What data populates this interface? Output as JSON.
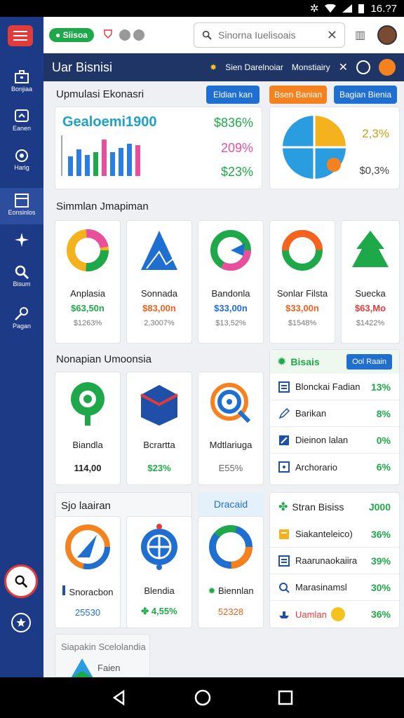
{
  "status_bar": {
    "time": "16.?7"
  },
  "sidebar": {
    "items": [
      {
        "label": "Bonjiaa",
        "icon": "briefcase-icon"
      },
      {
        "label": "Eanen",
        "icon": "shield-icon"
      },
      {
        "label": "Harig",
        "icon": "settings-icon"
      },
      {
        "label": "Eonsinlos",
        "icon": "calendar-icon"
      },
      {
        "label": "",
        "icon": "plane-icon"
      },
      {
        "label": "Bisum",
        "icon": "search-icon"
      },
      {
        "label": "Pagan",
        "icon": "key-icon"
      }
    ]
  },
  "topbar": {
    "badge": "Siisoa",
    "search_placeholder": "Sinorna Iuelisoais"
  },
  "header": {
    "title": "Uar Bisnisi",
    "link1": "Sien Darelnoiar",
    "link2": "Monstiairy"
  },
  "econ": {
    "section_title": "Upmulasi Ekonasri",
    "btn1": "Eldian kan",
    "btn2": "Bsen Banian",
    "btn3": "Bagian Bienia",
    "chart_title": "Gealoemi1900",
    "stat1": "$836%",
    "stat2": "209%",
    "stat3": "$23%",
    "globe_stat1": "2,3%",
    "globe_stat2": "$0,3%"
  },
  "simmlan": {
    "section_title": "Simmlan Jmapiman",
    "tiles": [
      {
        "name": "Anplasia",
        "value": "$63,50n",
        "sub": "$1263%"
      },
      {
        "name": "Sonnada",
        "value": "$83,00n",
        "sub": "2,3007%"
      },
      {
        "name": "Bandonla",
        "value": "$33,00n",
        "sub": "$13,52%"
      },
      {
        "name": "Sonlar Filsta",
        "value": "$33,00n",
        "sub": "$1548%"
      },
      {
        "name": "Suecka",
        "value": "$63,Mo",
        "sub": "$1422%"
      }
    ]
  },
  "nonapian": {
    "section_title": "Nonapian Umoonsia",
    "tiles": [
      {
        "name": "Biandla",
        "value": "114,00"
      },
      {
        "name": "Bcrartta",
        "value": "$23%"
      },
      {
        "name": "Mdtlariuga",
        "value": "E55%"
      }
    ]
  },
  "bisais": {
    "title": "Bisais",
    "button": "Ool Raain",
    "rows": [
      {
        "label": "Blonckai Fadian",
        "pct": "13%"
      },
      {
        "label": "Barikan",
        "pct": "8%"
      },
      {
        "label": "Dieinon lalan",
        "pct": "0%"
      },
      {
        "label": "Archorario",
        "pct": "6%"
      }
    ]
  },
  "sjo": {
    "section_title": "Sjo laairan",
    "side_title": "Dracaid",
    "tiles": [
      {
        "name": "Snoracbon",
        "value": "25530"
      },
      {
        "name": "Blendia",
        "value": "4,55%"
      },
      {
        "name": "Biennlan",
        "value": "52328"
      }
    ]
  },
  "stran": {
    "title": "Stran Bisiss",
    "title_value": "J000",
    "rows": [
      {
        "label": "Siakanteleico)",
        "pct": "36%"
      },
      {
        "label": "Raarunaokaiira",
        "pct": "39%"
      },
      {
        "label": "Marasinamsl",
        "pct": "30%"
      },
      {
        "label": "Uamlan",
        "pct": "36%"
      }
    ]
  },
  "bottom_card": {
    "title": "Siapakin Scelolandia",
    "item": "Faien"
  },
  "colors": {
    "sidebar": "#1c3a86",
    "header": "#1e3566",
    "green": "#1fa84a",
    "accent_blue": "#1f6fd1",
    "orange": "#f5821f",
    "red": "#e23b3b"
  }
}
